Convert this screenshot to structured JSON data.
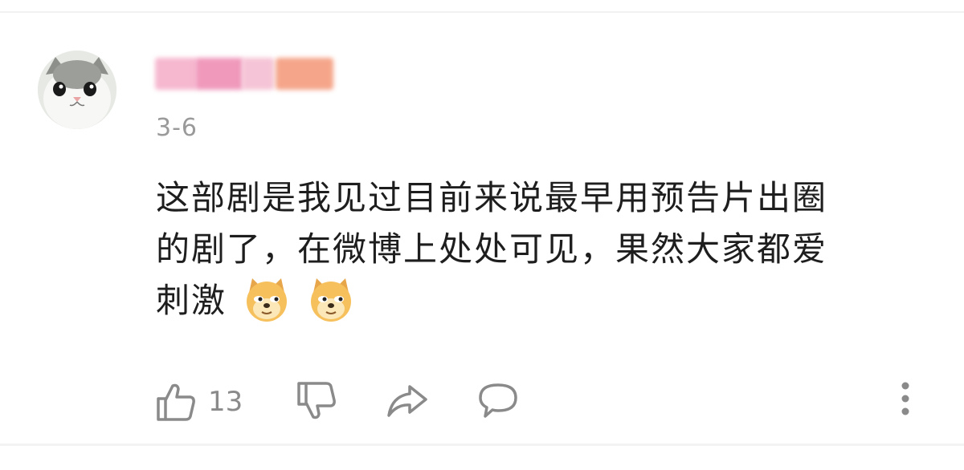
{
  "comment": {
    "date": "3-6",
    "lines": [
      "这部剧是我见过目前来说最早用预告片出圈",
      "的剧了，在微博上处处可见，果然大家都爱",
      "刺激"
    ],
    "emojis": [
      "doge-emoji",
      "doge-emoji"
    ]
  },
  "actions": {
    "like_count": "13",
    "icons": [
      "thumbs-up-icon",
      "thumbs-down-icon",
      "share-icon",
      "reply-icon",
      "more-options-icon"
    ]
  },
  "colors": {
    "text": "#1e1e1e",
    "muted": "#9a9a9a",
    "icon": "#8a8a8a",
    "username_blur_pink": "#f3a9c6",
    "username_blur_orange": "#f5a58a"
  }
}
